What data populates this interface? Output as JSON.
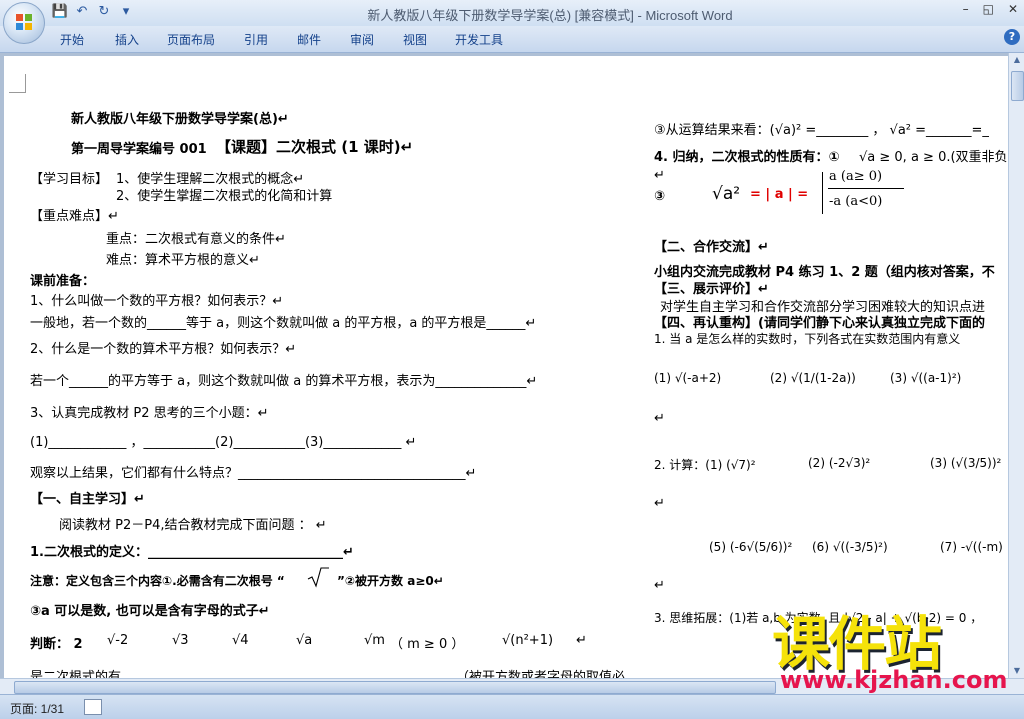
{
  "window": {
    "title": "新人教版八年级下册数学导学案(总) [兼容模式]",
    "app": "Microsoft Word",
    "minimize": "–",
    "restore": "◱",
    "close": "✕"
  },
  "qat": {
    "save_icon": "save-icon",
    "undo": "↶",
    "redo": "↻",
    "more": "▾"
  },
  "ribbon": {
    "tabs": [
      "开始",
      "插入",
      "页面布局",
      "引用",
      "邮件",
      "审阅",
      "视图",
      "开发工具"
    ],
    "help": "?"
  },
  "doc": {
    "title": "新人教版八年级下册数学导学案(总)↵",
    "heading_left": "第一周导学案编号 001",
    "heading_right": "【课题】二次根式 (1 课时)↵",
    "goal_label": "【学习目标】",
    "goal1": "1、使学生理解二次根式的概念↵",
    "goal2": "2、使学生掌握二次根式的化简和计算",
    "key_label": "【重点难点】↵",
    "key1": "重点：二次根式有意义的条件↵",
    "key2": "难点：算术平方根的意义↵",
    "prep": "课前准备：",
    "q1": "1、什么叫做一个数的平方根？如何表示？↵",
    "q1_body": "一般地，若一个数的______等于 a，则这个数就叫做 a 的平方根，a 的平方根是______↵",
    "q2": "2、什么是一个数的算术平方根？如何表示？↵",
    "q2_body": "若一个______的平方等于 a，则这个数就叫做 a 的算术平方根，表示为______________↵",
    "q3": "3、认真完成教材 P2 思考的三个小题：↵",
    "q3_body": "(1)____________ ，___________(2)___________(3)____________ ↵",
    "observe": "观察以上结果，它们都有什么特点？___________________________________↵",
    "sec1": "【一、自主学习】↵",
    "read": "阅读教材 P2－P4,结合教材完成下面问题 ： ↵",
    "def": "1.二次根式的定义：______________________________↵",
    "note": "注意：定义包含三个内容①.必需含有二次根号 “",
    "note_end": "”②被开方数 a≥0↵",
    "note3": "③a 可以是数, 也可以是含有字母的式子↵",
    "judge": "判断：  2",
    "judge_items": [
      "√-2",
      "√3",
      "√4",
      "√a",
      "√m",
      "（ m ≥ 0 ）",
      "√(n²+1)"
    ],
    "judge_end": "↵",
    "bottom_left": "是二次根式的有",
    "bottom_right": "（被开方数或者字母的取值必",
    "r_calc": "③从运算结果来看：(√a)² =________ ， √a² =_______=_",
    "r_prop": "4. 归纳，二次根式的性质有：①",
    "r_prop_tail": "√a ≥ 0, a ≥ 0.(双重非负",
    "r_arrow1": "↵",
    "r3_label": "③",
    "r3_expr": "√a²",
    "r3_eq": "= | a | =",
    "r3_case1": "a   (a≥ 0)",
    "r3_case2": "-a   (a<0)",
    "sec2": "【二、合作交流】↵",
    "coop": "小组内交流完成教材 P4 练习 1、2 题（组内核对答案，不",
    "sec3": "【三、展示评价】↵",
    "show": "对学生自主学习和合作交流部分学习困难较大的知识点进",
    "sec4": "【四、再认重构】(请同学们静下心来认真独立完成下面的",
    "ex1": "1. 当 a 是怎么样的实数时，下列各式在实数范围内有意义",
    "ex1_items": [
      "(1) √(-a+2)",
      "(2) √(1/(1-2a))",
      "(3) √((a-1)²)"
    ],
    "ex2": "2. 计算：(1) (√7)²",
    "ex2_items": [
      "(2) (-2√3)²",
      "(3) (√(3/5))²"
    ],
    "ex3_items": [
      "(5) (-6√(5/6))²",
      "(6) √((-3/5)²)",
      "(7) -√((-m)"
    ],
    "ex4": "3. 思维拓展：(1)若 a,b 为实数, 且 |√2 - a| + √(b-2) = 0  ，",
    "arrow": "↵"
  },
  "status": {
    "page": "页面: 1/31"
  },
  "watermark": {
    "big": "课件站",
    "url": "www.kjzhan.com"
  }
}
